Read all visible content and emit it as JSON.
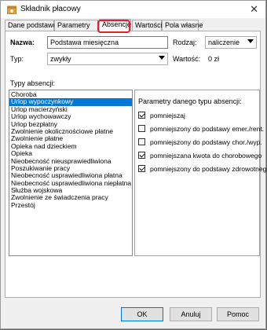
{
  "window": {
    "title": "Składnik płacowy",
    "close_glyph": "✕"
  },
  "tabs": [
    {
      "label": "Dane podstawowe"
    },
    {
      "label": "Parametry"
    },
    {
      "label": "Absencje"
    },
    {
      "label": "Wartości"
    },
    {
      "label": "Pola własne"
    }
  ],
  "form": {
    "nazwa_label": "Nazwa:",
    "nazwa_value": "Podstawa miesięczna",
    "rodzaj_label": "Rodzaj:",
    "rodzaj_value": "naliczenie",
    "typ_label": "Typ:",
    "typ_value": "zwykły",
    "wartosc_label": "Wartość:",
    "wartosc_value": "0 zł"
  },
  "absence": {
    "label": "Typy absencji:",
    "items": [
      "Choroba",
      "Urlop wypoczynkowy",
      "Urlop macierzyński",
      "Urlop wychowawczy",
      "Urlop bezpłatny",
      "Zwolnienie okolicznościowe płatne",
      "Zwolnienie płatne",
      "Opieka nad dzieckiem",
      "Opieka",
      "Nieobecność nieusprawiedliwiona",
      "Poszukiwanie pracy",
      "Nieobecność usprawiedliwiona płatna",
      "Nieobecność usprawiedliwiona niepłatna",
      "Służba wojskowa",
      "Zwolnienie ze świadczenia pracy",
      "Przestój"
    ],
    "selected_index": 1
  },
  "params": {
    "label": "Parametry danego typu absencji:",
    "checkboxes": [
      {
        "label": "pomniejszaj",
        "checked": true
      },
      {
        "label": "pomniejszony do podstawy emer./rent.",
        "checked": false
      },
      {
        "label": "pomniejszony do podstawy chor./wyp.",
        "checked": false
      },
      {
        "label": "pomniejszana kwota do chorobowego",
        "checked": true
      },
      {
        "label": "pomniejszony do podstawy zdrowotnego",
        "checked": true
      }
    ]
  },
  "buttons": {
    "ok": "OK",
    "cancel": "Anuluj",
    "help": "Pomoc"
  },
  "colors": {
    "selection": "#0078d7",
    "tab_highlight": "#e0202a"
  },
  "icons": {
    "app": "payroll-icon",
    "close": "close-icon"
  }
}
